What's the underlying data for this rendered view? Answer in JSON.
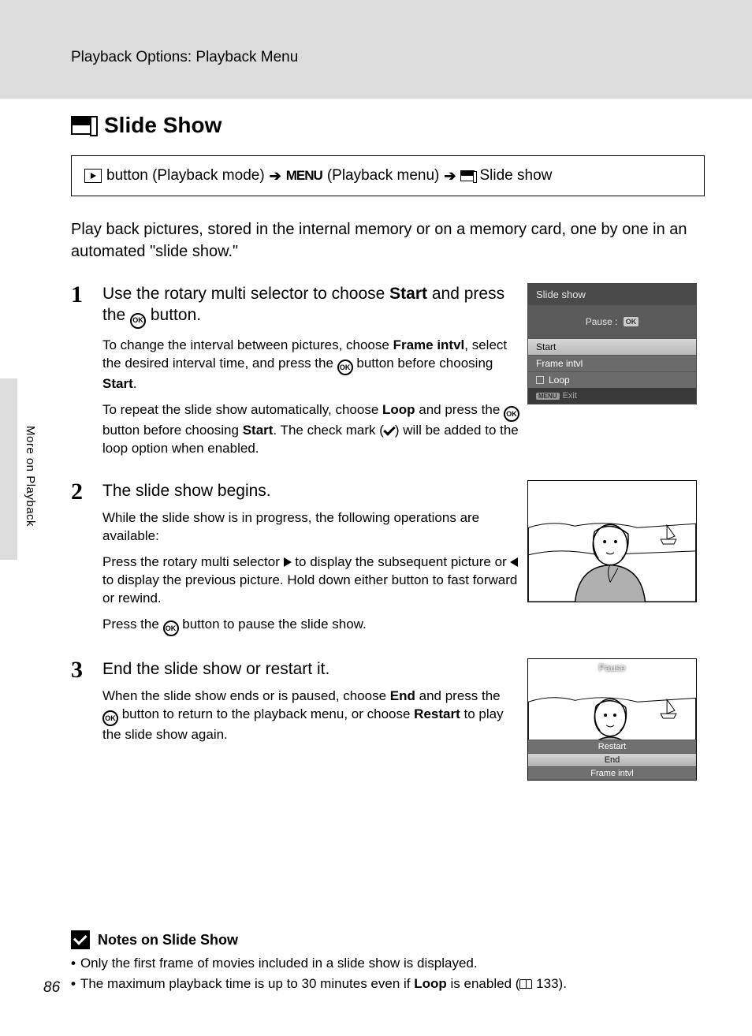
{
  "header": {
    "section_path": "Playback Options: Playback Menu"
  },
  "title": "Slide Show",
  "breadcrumb": {
    "btn_label": "button (Playback mode)",
    "menu_label": "MENU",
    "menu_suffix": "(Playback menu)",
    "dest": "Slide show"
  },
  "intro": "Play back pictures, stored in the internal memory or on a memory card, one by one in an automated \"slide show.\"",
  "steps": [
    {
      "num": "1",
      "heading_pre": "Use the rotary multi selector to choose ",
      "heading_bold": "Start",
      "heading_post": " and press the ",
      "heading_tail": " button.",
      "p1_a": "To change the interval between pictures, choose ",
      "p1_b1": "Frame intvl",
      "p1_c": ", select the desired interval time, and press the ",
      "p1_d": " button before choosing ",
      "p1_b2": "Start",
      "p1_e": ".",
      "p2_a": "To repeat the slide show automatically, choose ",
      "p2_b1": "Loop",
      "p2_c": " and press the ",
      "p2_d": " button before choosing ",
      "p2_b2": "Start",
      "p2_e": ". The check mark (",
      "p2_f": ") will be added to the loop option when enabled."
    },
    {
      "num": "2",
      "heading": "The slide show begins.",
      "p1": "While the slide show is in progress, the following operations are available:",
      "p2_a": "Press the rotary multi selector ",
      "p2_b": " to display the subsequent picture or ",
      "p2_c": " to display the previous picture. Hold down either button to fast forward or rewind.",
      "p3_a": "Press the ",
      "p3_b": " button to pause the slide show."
    },
    {
      "num": "3",
      "heading": "End the slide show or restart it.",
      "p1_a": "When the slide show ends or is paused, choose ",
      "p1_b1": "End",
      "p1_c": " and press the ",
      "p1_d": " button to return to the playback menu, or choose ",
      "p1_b2": "Restart",
      "p1_e": " to play the slide show again."
    }
  ],
  "lcd1": {
    "title": "Slide show",
    "pause_label": "Pause",
    "ok": "OK",
    "items": [
      "Start",
      "Frame intvl",
      "Loop"
    ],
    "exit": "Exit",
    "menu_badge": "MENU"
  },
  "lcd3": {
    "pause": "Pause",
    "buttons": [
      "Restart",
      "End",
      "Frame intvl"
    ]
  },
  "notes": {
    "title": "Notes on Slide Show",
    "items": [
      "Only the first frame of movies included in a slide show is displayed.",
      {
        "pre": "The maximum playback time is up to 30 minutes even if ",
        "bold": "Loop",
        "post": " is enabled (",
        "ref": "133",
        "tail": ")."
      }
    ]
  },
  "side_tab": "More on Playback",
  "page_number": "86"
}
